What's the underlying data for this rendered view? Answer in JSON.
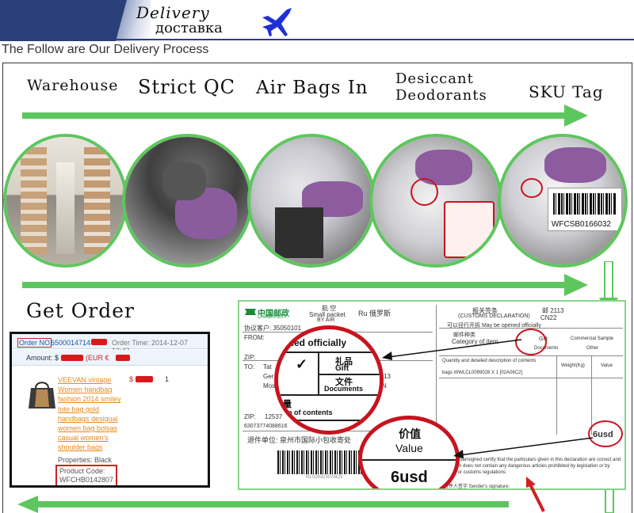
{
  "banner": {
    "title": "Delivery",
    "subtitle": "доставка"
  },
  "intro": "The Follow are Our Delivery Process",
  "steps": [
    {
      "label_1": "Warehouse"
    },
    {
      "label_1": "Strict QC"
    },
    {
      "label_1": "Air Bags In"
    },
    {
      "label_1": "Desiccant",
      "label_2": "Deodorants"
    },
    {
      "label_1": "SKU Tag"
    }
  ],
  "sku_tag_code": "WFCSB0166032",
  "get_order": "Get Order",
  "order": {
    "order_no_label": "Order NO",
    "order_no_value": "6500014714",
    "order_time": "Order Time: 2014-12-07 13:42",
    "amount_label": "Amount: $",
    "amount_currency": "(EUR €",
    "item_title": "VEEVAN vintage Women handbag fashion 2014 smiley tote bag gold handbags desigual women bag bolsas casual women's shoulder bags",
    "item_price": "$",
    "item_qty": "1",
    "properties": "Properties: Black",
    "product_code_label": "Product Code:",
    "product_code_value": "WFCHB0142807"
  },
  "declaration": {
    "china_post": "中国邮政",
    "china_post_en": "CHINA POST",
    "airmail_cn": "航 空",
    "small_packet": "Small packet",
    "by_air": "BY AIR",
    "dest_label": "Ru 俄罗斯",
    "customer_label": "协议客户: 35050101",
    "from_label": "FROM:",
    "zip_label": "ZIP:",
    "to_label": "TO:",
    "sender_unit": "退件单位: 泉州市国际小包收寄处",
    "tracking": "RL026323078CN",
    "customs_title": "报关签条",
    "customs_en": "(CUSTOMS DECLARATION)",
    "postal_code": "邮 2113",
    "cn22": "CN22",
    "may_be_opened": "可以径行开拆  May be opened officially",
    "category": "Category of item",
    "category_cn": "邮件种类",
    "gift": "Gift",
    "documents": "Documents",
    "commercial_sample": "Commercial Sample",
    "other": "Other",
    "contents_line": "Quantity and detailed description of contents",
    "weight_label": "Weight(Kg)",
    "value_label": "Value",
    "item_desc": "bags WWLCL0099028 X 1 [02A06C2]",
    "certify_text": "I, the undersigned certify that the particulars given in this declaration are correct and this item does not contain any dangerous articles prohibited by legislation or by postal or customs regulations",
    "sender_signature": "寄件人签字 Sender's signature:",
    "value_small": "6usd",
    "zoom1_officially": "ened officially",
    "zoom1_gift_cn": "礼品",
    "zoom1_gift": "Gift",
    "zoom1_doc_cn": "文件",
    "zoom1_documents": "Documents",
    "zoom1_contents": "ion of contents",
    "zoom1_qty": "量",
    "zoom1_check": "✓",
    "zoom2_value_cn": "价值",
    "zoom2_value": "Value",
    "zoom2_amount": "6usd"
  },
  "colors": {
    "banner_navy": "#2a3f78",
    "plane_blue": "#1f2fd6",
    "arrow_green": "#5ec65e",
    "circle_border": "#5ec65e",
    "accent_red": "#c8141e",
    "order_link": "#e6891b"
  },
  "icons": {
    "plane": "airplane-icon"
  }
}
